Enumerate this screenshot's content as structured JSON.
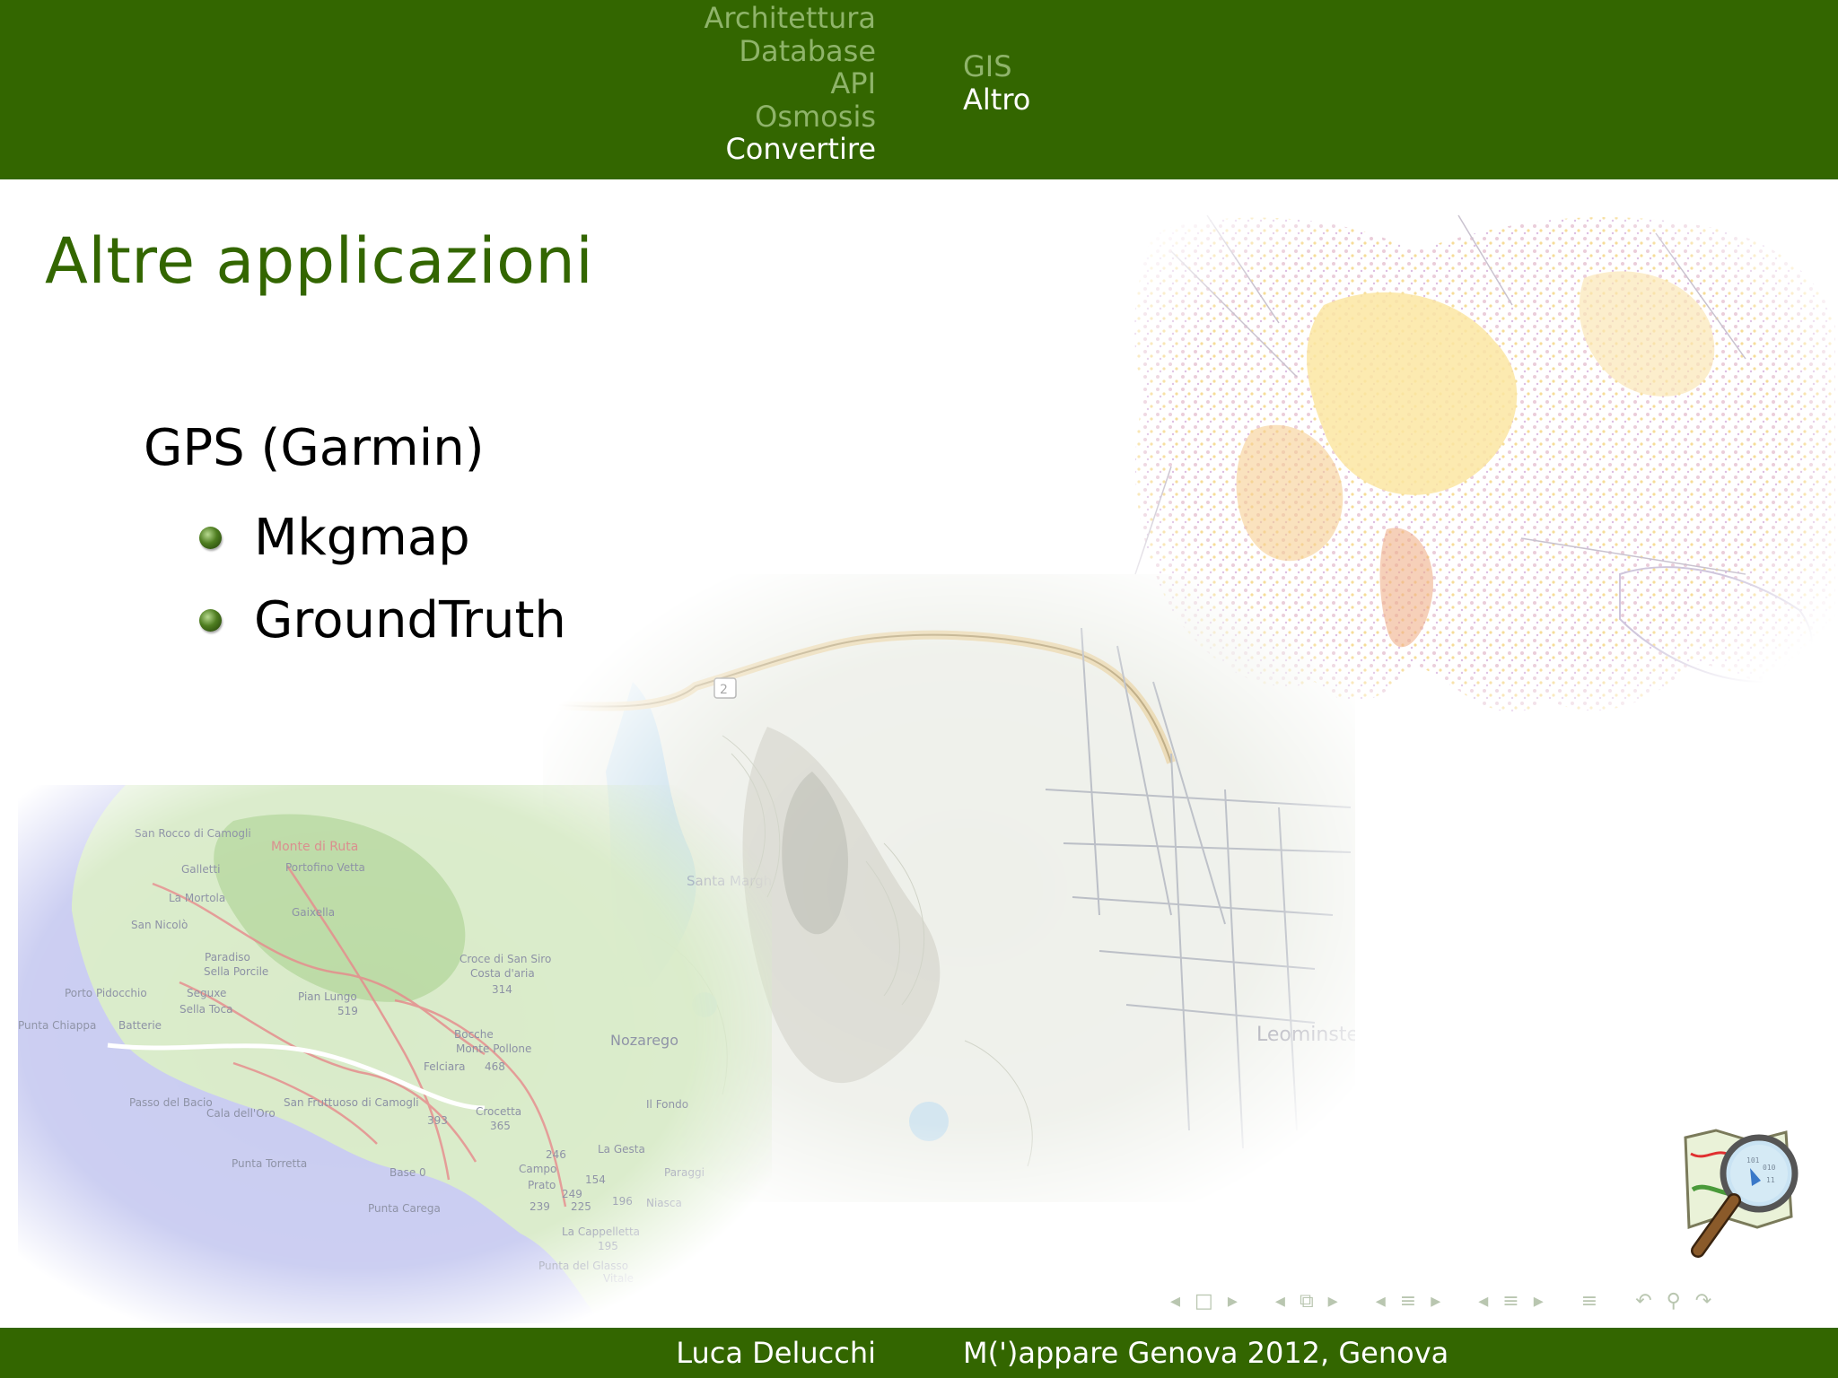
{
  "header": {
    "sections": [
      {
        "label": "Architettura",
        "current": false
      },
      {
        "label": "Database",
        "current": false
      },
      {
        "label": "API",
        "current": false
      },
      {
        "label": "Osmosis",
        "current": false
      },
      {
        "label": "Convertire",
        "current": true
      }
    ],
    "subsections": [
      {
        "label": "GIS",
        "current": false
      },
      {
        "label": "Altro",
        "current": true
      }
    ]
  },
  "slide": {
    "title": "Altre applicazioni",
    "heading": "GPS (Garmin)",
    "items": [
      "Mkgmap",
      "GroundTruth"
    ]
  },
  "map_labels": {
    "coast": [
      "San Rocco di Camogli",
      "Monte di Ruta",
      "Galletti",
      "Portofino Vetta",
      "La Mortola",
      "Gaixella",
      "San Nicolò",
      "Paradiso",
      "Sella Porcile",
      "Porto Pidocchio",
      "Seguxe",
      "Pian Lungo",
      "519",
      "Sella Toca",
      "Punta Chiappa",
      "Batterie",
      "Croce di San Siro",
      "Costa d'aria",
      "314",
      "Bocche",
      "Monte Pollone",
      "Felciara",
      "468",
      "Passo del Bacio",
      "Cala dell'Oro",
      "San Fruttuoso di Camogli",
      "393",
      "Crocetta",
      "365",
      "Punta Torretta",
      "Base 0",
      "Punta Carega",
      "Campo",
      "246",
      "154",
      "Prato",
      "249",
      "225",
      "239",
      "196",
      "Nozarego",
      "Santa Margherita Ligure",
      "La Gesta",
      "Paraggi",
      "Niasca",
      "La Cappelletta",
      "195",
      "Punta del Glasso",
      "Vitale",
      "Il Fondo"
    ],
    "terrain": [
      "Leominster",
      "2"
    ]
  },
  "navigation": {
    "prev": "◂",
    "next": "▸",
    "frame": "□",
    "subsection": "⧉",
    "section": "≡",
    "doc": "≡",
    "undo": "↶",
    "search": "⚲",
    "redo": "↷"
  },
  "footer": {
    "author": "Luca Delucchi",
    "title": "M(')appare Genova 2012, Genova"
  },
  "colors": {
    "bar": "#336600",
    "nav_dim": "#8fb46a",
    "title": "#336600"
  }
}
